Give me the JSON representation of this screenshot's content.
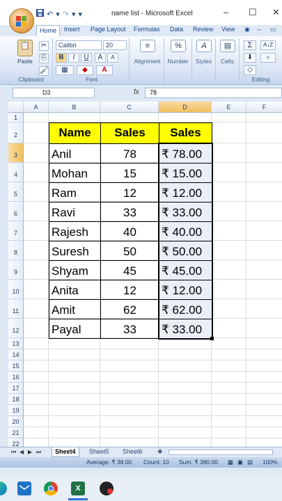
{
  "window": {
    "title": "name list - Microsoft Excel",
    "minimize_glyph": "–",
    "maximize_glyph": "☐",
    "close_glyph": "✕"
  },
  "qat": {
    "save_icon": "save-icon",
    "undo_glyph": "↶",
    "redo_glyph": "↷"
  },
  "ribbon": {
    "tabs": [
      "Home",
      "Insert",
      "Page Layout",
      "Formulas",
      "Data",
      "Review",
      "View"
    ],
    "clipboard": {
      "paste_label": "Paste",
      "group_label": "Clipboard"
    },
    "font": {
      "name": "Calibri",
      "size": "20",
      "bold": "B",
      "italic": "I",
      "underline": "U",
      "group_label": "Font"
    },
    "alignment_label": "Alignment",
    "number_label": "Number",
    "number_symbol": "%",
    "styles_label": "Styles",
    "styles_symbol": "A",
    "cells_label": "Cells",
    "editing_label": "Editing",
    "editing_sigma": "Σ",
    "editing_sort": "A↓Z"
  },
  "formula_bar": {
    "name_box": "D3",
    "fx": "fx",
    "value": "78"
  },
  "columns": [
    "A",
    "B",
    "C",
    "D",
    "E",
    "F"
  ],
  "rows": [
    "1",
    "2",
    "3",
    "4",
    "5",
    "6",
    "7",
    "8",
    "9",
    "10",
    "11",
    "12",
    "13",
    "14",
    "15",
    "16",
    "17",
    "18",
    "19",
    "20",
    "21",
    "22"
  ],
  "table": {
    "headers": [
      "Name",
      "Sales",
      "Sales"
    ],
    "rows": [
      {
        "name": "Anil",
        "sales": "78",
        "amount": "₹ 78.00"
      },
      {
        "name": "Mohan",
        "sales": "15",
        "amount": "₹ 15.00"
      },
      {
        "name": "Ram",
        "sales": "12",
        "amount": "₹ 12.00"
      },
      {
        "name": "Ravi",
        "sales": "33",
        "amount": "₹ 33.00"
      },
      {
        "name": "Rajesh",
        "sales": "40",
        "amount": "₹ 40.00"
      },
      {
        "name": "Suresh",
        "sales": "50",
        "amount": "₹ 50.00"
      },
      {
        "name": "Shyam",
        "sales": "45",
        "amount": "₹ 45.00"
      },
      {
        "name": "Anita",
        "sales": "12",
        "amount": "₹ 12.00"
      },
      {
        "name": "Amit",
        "sales": "62",
        "amount": "₹ 62.00"
      },
      {
        "name": "Payal",
        "sales": "33",
        "amount": "₹ 33.00"
      }
    ]
  },
  "sheets": [
    "Sheet4",
    "Sheet5",
    "Sheet6"
  ],
  "sheet_nav": [
    "⏮",
    "◀",
    "▶",
    "⏭"
  ],
  "status": {
    "average": "Average: ₹ 38.00",
    "count": "Count: 10",
    "sum": "Sum: ₹ 380.00",
    "zoom": "100%"
  },
  "taskbar": [
    "edge-icon",
    "mail-icon",
    "chrome-icon",
    "excel-icon",
    "app-icon"
  ],
  "colors": {
    "header_fill": "#ffff00",
    "selected_header": "#f1c15f",
    "ribbon_blue": "#15428b"
  }
}
